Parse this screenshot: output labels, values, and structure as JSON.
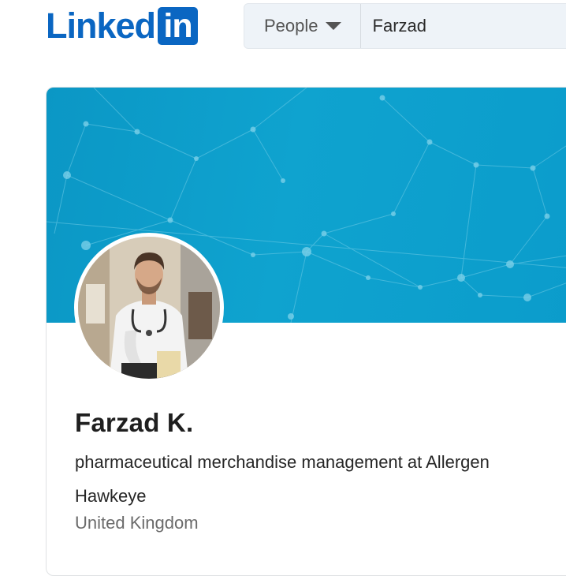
{
  "header": {
    "logo_text": "Linked",
    "logo_box_text": "in",
    "brand_color": "#0a66c2",
    "search_type": "People",
    "search_value": "Farzad"
  },
  "profile": {
    "name": "Farzad K.",
    "headline": "pharmaceutical merchandise management at Allergen Hawkeye",
    "location": "United Kingdom",
    "banner_color": "#0fa3cf"
  }
}
